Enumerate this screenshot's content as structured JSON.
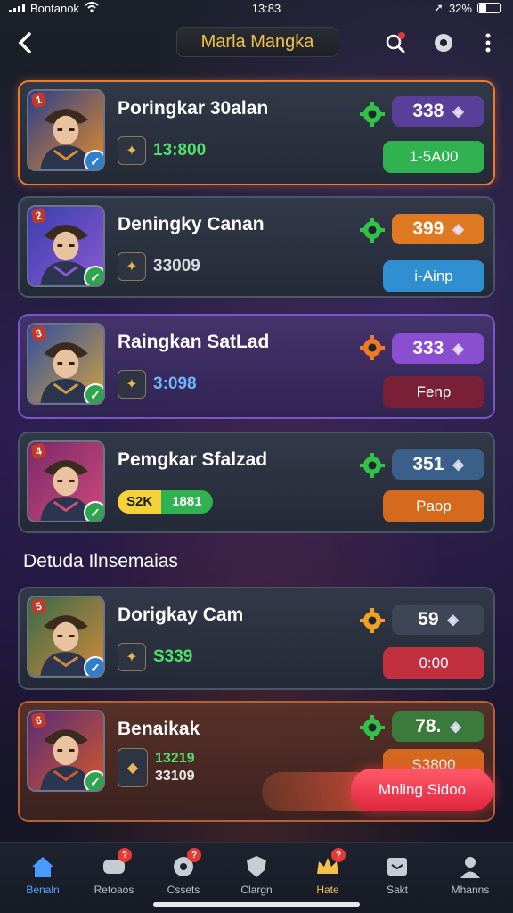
{
  "status_bar": {
    "carrier": "Bontanok",
    "time": "13:83",
    "battery": "32%"
  },
  "header": {
    "title": "Marla Mangka"
  },
  "entries": [
    {
      "rank": "1",
      "name": "Poringkar 30alan",
      "sub_value": "13:800",
      "score": "338",
      "action": "1-5A00",
      "avatar_colors": [
        "#2a3f8a",
        "#e38a2a"
      ],
      "gear_color": "#32c24a",
      "score_color": "#5a3f9a",
      "action_color": "#2fb24f",
      "sub_color": "#4ee06a",
      "check": "blue"
    },
    {
      "rank": "2",
      "name": "Deningky Canan",
      "sub_value": "33009",
      "score": "399",
      "action": "i-Ainp",
      "avatar_colors": [
        "#3a3fb0",
        "#8a5ad0"
      ],
      "gear_color": "#32c24a",
      "score_color": "#e07a22",
      "action_color": "#2f8fd1",
      "sub_color": "#d6d9df",
      "check": "green"
    },
    {
      "rank": "3",
      "name": "Raingkan SatLad",
      "sub_value": "3:098",
      "score": "333",
      "action": "Fenp",
      "avatar_colors": [
        "#2f4fa0",
        "#d0a040"
      ],
      "gear_color": "#f07a22",
      "score_color": "#8a4fd0",
      "action_color": "#7a2036",
      "sub_color": "#6fb4ff",
      "check": "green"
    },
    {
      "rank": "4",
      "name": "Pemgkar Sfalzad",
      "sub_value": "1881",
      "sub_pill": "S2K",
      "score": "351",
      "action": "Paop",
      "avatar_colors": [
        "#7a2a6a",
        "#d04a7a"
      ],
      "gear_color": "#32c24a",
      "score_color": "#3a5f88",
      "action_color": "#d5691e",
      "sub_color": "#ffffff",
      "check": "green"
    }
  ],
  "section_label": "Detuda Ilnsemaias",
  "entries2": [
    {
      "rank": "5",
      "name": "Dorigkay Cam",
      "sub_value": "S339",
      "score": "59",
      "action": "0:00",
      "avatar_colors": [
        "#3a6a4a",
        "#d08a3a"
      ],
      "gear_color": "#f0a022",
      "score_color": "#3e4656",
      "action_color": "#c23040",
      "sub_color": "#4ee06a",
      "check": "blue"
    },
    {
      "rank": "6",
      "name": "Benaikak",
      "sub_value": "13219",
      "sub_value_b": "33109",
      "score": "78.",
      "action": "S3800",
      "avatar_colors": [
        "#5a2a7a",
        "#d05a2a"
      ],
      "gear_color": "#32c24a",
      "score_color": "#3a7a3a",
      "action_color": "#d5691e",
      "sub_color": "#4ee06a",
      "check": "green"
    }
  ],
  "cta_label": "Mnling Sidoo",
  "nav": [
    {
      "label": "Benaln",
      "icon": "home-icon",
      "badge": ""
    },
    {
      "label": "Retoaos",
      "icon": "chat-icon",
      "badge": "?"
    },
    {
      "label": "Cssets",
      "icon": "gear-face-icon",
      "badge": "?"
    },
    {
      "label": "Clargn",
      "icon": "shield-icon",
      "badge": ""
    },
    {
      "label": "Hate",
      "icon": "crown-icon",
      "badge": "?"
    },
    {
      "label": "Sakt",
      "icon": "inbox-icon",
      "badge": ""
    },
    {
      "label": "Mhanns",
      "icon": "person-icon",
      "badge": ""
    }
  ],
  "colors": {
    "accent_gold": "#f3c14a",
    "active_blue": "#5aa3ff"
  }
}
